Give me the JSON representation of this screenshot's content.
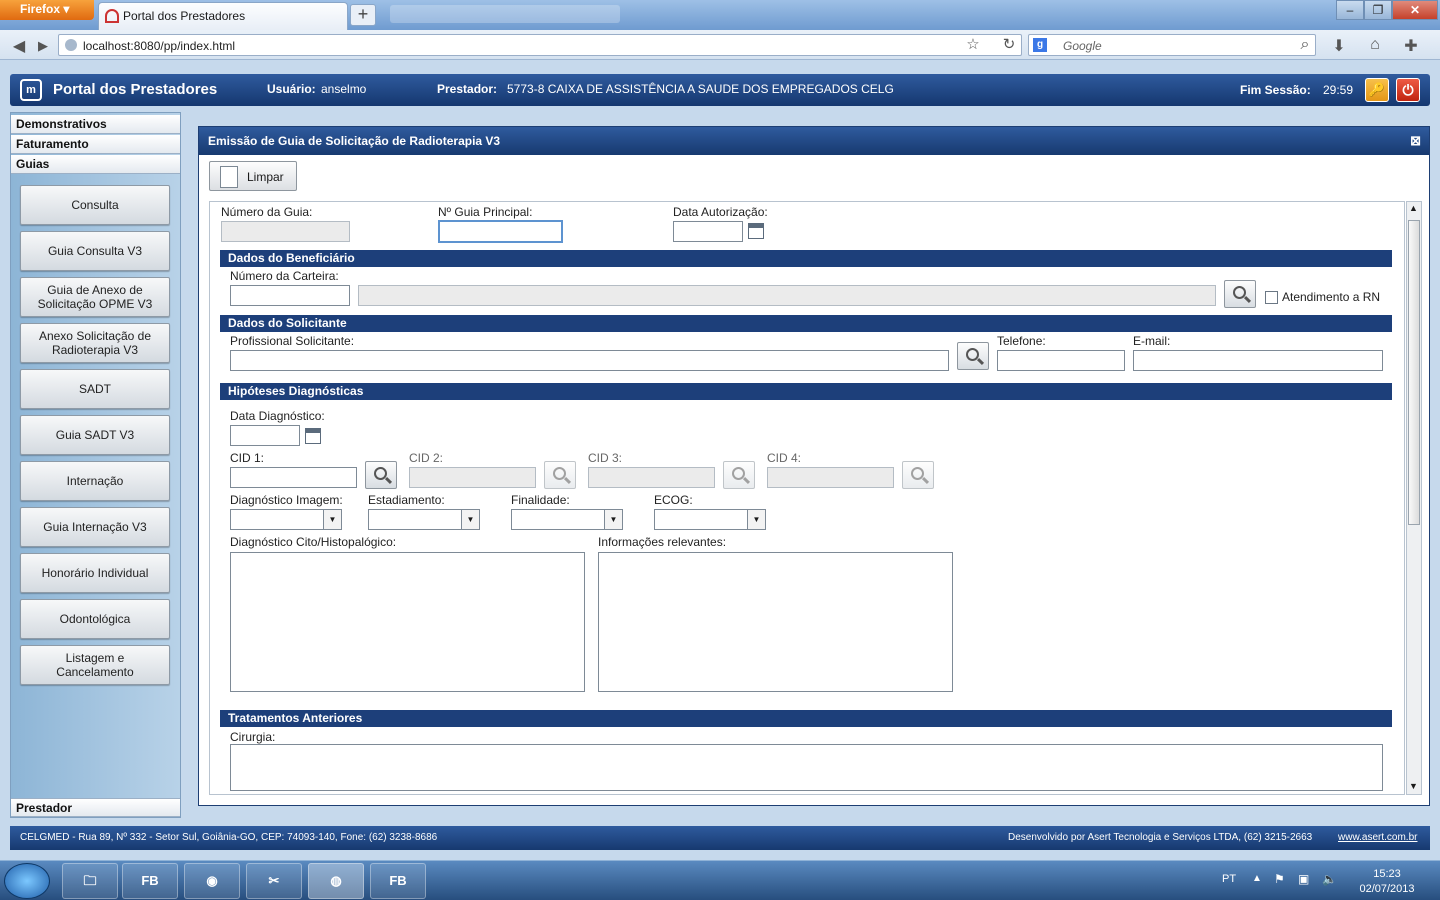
{
  "browser": {
    "menu_label": "Firefox",
    "tab_title": "Portal dos Prestadores",
    "new_tab_label": "+",
    "url": "localhost:8080/pp/index.html",
    "search_placeholder": "Google"
  },
  "header": {
    "title": "Portal dos Prestadores",
    "user_label": "Usuário:",
    "user_value": "anselmo",
    "provider_label": "Prestador:",
    "provider_value": "5773-8 CAIXA DE ASSISTÊNCIA A SAUDE DOS EMPREGADOS CELG",
    "session_label": "Fim Sessão:",
    "session_value": "29:59"
  },
  "sidebar": {
    "sections": [
      "Demonstrativos",
      "Faturamento",
      "Guias"
    ],
    "items": [
      {
        "label": "Consulta"
      },
      {
        "label": "Guia Consulta V3"
      },
      {
        "label": "Guia de Anexo de Solicitação OPME V3"
      },
      {
        "label": "Anexo Solicitação de Radioterapia V3"
      },
      {
        "label": "SADT"
      },
      {
        "label": "Guia SADT V3"
      },
      {
        "label": "Internação"
      },
      {
        "label": "Guia Internação V3"
      },
      {
        "label": "Honorário Individual"
      },
      {
        "label": "Odontológica"
      },
      {
        "label": "Listagem e Cancelamento"
      }
    ],
    "bottom_section": "Prestador"
  },
  "panel": {
    "title": "Emissão de Guia de Solicitação de Radioterapia V3",
    "clear_button": "Limpar"
  },
  "form": {
    "numero_guia": "Número da Guia:",
    "guia_principal": "Nº Guia Principal:",
    "data_autorizacao": "Data Autorização:",
    "sec_beneficiario": "Dados do Beneficiário",
    "numero_carteira": "Número da Carteira:",
    "atendimento_rn": "Atendimento a RN",
    "sec_solicitante": "Dados do Solicitante",
    "profissional": "Profissional Solicitante:",
    "telefone": "Telefone:",
    "email": "E-mail:",
    "sec_hipoteses": "Hipóteses Diagnósticas",
    "data_diagnostico": "Data Diagnóstico:",
    "cid1": "CID 1:",
    "cid2": "CID 2:",
    "cid3": "CID 3:",
    "cid4": "CID 4:",
    "diag_imagem": "Diagnóstico Imagem:",
    "estadiamento": "Estadiamento:",
    "finalidade": "Finalidade:",
    "ecog": "ECOG:",
    "diag_cito": "Diagnóstico Cito/Histopalógico:",
    "info_relevantes": "Informações relevantes:",
    "sec_tratamentos": "Tratamentos Anteriores",
    "cirurgia": "Cirurgia:"
  },
  "footer": {
    "address": "CELGMED - Rua 89, Nº 332 - Setor Sul, Goiânia-GO, CEP: 74093-140, Fone: (62) 3238-8686",
    "developer": "Desenvolvido por Asert Tecnologia e Serviços LTDA, (62) 3215-2663",
    "link": "www.asert.com.br"
  },
  "taskbar": {
    "lang": "PT",
    "time": "15:23",
    "date": "02/07/2013",
    "apps": [
      "FB",
      "FB"
    ]
  },
  "colors": {
    "header_blue": "#1d3f7a",
    "panel_bg": "#ffffff"
  }
}
